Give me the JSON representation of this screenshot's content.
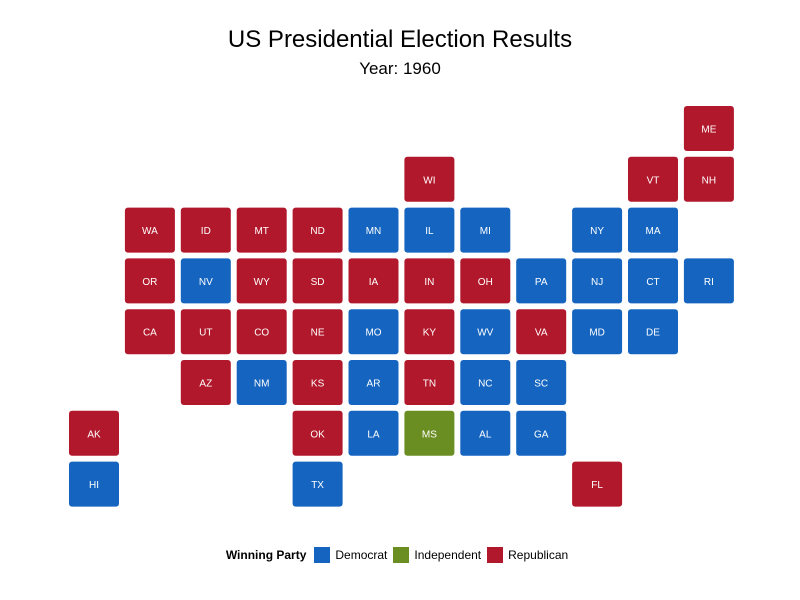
{
  "chart_data": {
    "type": "tile-map",
    "title": "US Presidential Election Results",
    "subtitle": "Year: 1960",
    "colors": {
      "Democrat": "#1565c0",
      "Independent": "#6b8e23",
      "Republican": "#b2182b"
    },
    "legend": {
      "title": "Winning Party",
      "placement": "bottom",
      "entries": [
        "Democrat",
        "Independent",
        "Republican"
      ]
    },
    "states": [
      {
        "state": "ME",
        "col": 11,
        "row": 0,
        "party": "Republican"
      },
      {
        "state": "WI",
        "col": 6,
        "row": 1,
        "party": "Republican"
      },
      {
        "state": "VT",
        "col": 10,
        "row": 1,
        "party": "Republican"
      },
      {
        "state": "NH",
        "col": 11,
        "row": 1,
        "party": "Republican"
      },
      {
        "state": "WA",
        "col": 1,
        "row": 2,
        "party": "Republican"
      },
      {
        "state": "ID",
        "col": 2,
        "row": 2,
        "party": "Republican"
      },
      {
        "state": "MT",
        "col": 3,
        "row": 2,
        "party": "Republican"
      },
      {
        "state": "ND",
        "col": 4,
        "row": 2,
        "party": "Republican"
      },
      {
        "state": "MN",
        "col": 5,
        "row": 2,
        "party": "Democrat"
      },
      {
        "state": "IL",
        "col": 6,
        "row": 2,
        "party": "Democrat"
      },
      {
        "state": "MI",
        "col": 7,
        "row": 2,
        "party": "Democrat"
      },
      {
        "state": "NY",
        "col": 9,
        "row": 2,
        "party": "Democrat"
      },
      {
        "state": "MA",
        "col": 10,
        "row": 2,
        "party": "Democrat"
      },
      {
        "state": "OR",
        "col": 1,
        "row": 3,
        "party": "Republican"
      },
      {
        "state": "NV",
        "col": 2,
        "row": 3,
        "party": "Democrat"
      },
      {
        "state": "WY",
        "col": 3,
        "row": 3,
        "party": "Republican"
      },
      {
        "state": "SD",
        "col": 4,
        "row": 3,
        "party": "Republican"
      },
      {
        "state": "IA",
        "col": 5,
        "row": 3,
        "party": "Republican"
      },
      {
        "state": "IN",
        "col": 6,
        "row": 3,
        "party": "Republican"
      },
      {
        "state": "OH",
        "col": 7,
        "row": 3,
        "party": "Republican"
      },
      {
        "state": "PA",
        "col": 8,
        "row": 3,
        "party": "Democrat"
      },
      {
        "state": "NJ",
        "col": 9,
        "row": 3,
        "party": "Democrat"
      },
      {
        "state": "CT",
        "col": 10,
        "row": 3,
        "party": "Democrat"
      },
      {
        "state": "RI",
        "col": 11,
        "row": 3,
        "party": "Democrat"
      },
      {
        "state": "CA",
        "col": 1,
        "row": 4,
        "party": "Republican"
      },
      {
        "state": "UT",
        "col": 2,
        "row": 4,
        "party": "Republican"
      },
      {
        "state": "CO",
        "col": 3,
        "row": 4,
        "party": "Republican"
      },
      {
        "state": "NE",
        "col": 4,
        "row": 4,
        "party": "Republican"
      },
      {
        "state": "MO",
        "col": 5,
        "row": 4,
        "party": "Democrat"
      },
      {
        "state": "KY",
        "col": 6,
        "row": 4,
        "party": "Republican"
      },
      {
        "state": "WV",
        "col": 7,
        "row": 4,
        "party": "Democrat"
      },
      {
        "state": "VA",
        "col": 8,
        "row": 4,
        "party": "Republican"
      },
      {
        "state": "MD",
        "col": 9,
        "row": 4,
        "party": "Democrat"
      },
      {
        "state": "DE",
        "col": 10,
        "row": 4,
        "party": "Democrat"
      },
      {
        "state": "AZ",
        "col": 2,
        "row": 5,
        "party": "Republican"
      },
      {
        "state": "NM",
        "col": 3,
        "row": 5,
        "party": "Democrat"
      },
      {
        "state": "KS",
        "col": 4,
        "row": 5,
        "party": "Republican"
      },
      {
        "state": "AR",
        "col": 5,
        "row": 5,
        "party": "Democrat"
      },
      {
        "state": "TN",
        "col": 6,
        "row": 5,
        "party": "Republican"
      },
      {
        "state": "NC",
        "col": 7,
        "row": 5,
        "party": "Democrat"
      },
      {
        "state": "SC",
        "col": 8,
        "row": 5,
        "party": "Democrat"
      },
      {
        "state": "AK",
        "col": 0,
        "row": 6,
        "party": "Republican"
      },
      {
        "state": "OK",
        "col": 4,
        "row": 6,
        "party": "Republican"
      },
      {
        "state": "LA",
        "col": 5,
        "row": 6,
        "party": "Democrat"
      },
      {
        "state": "MS",
        "col": 6,
        "row": 6,
        "party": "Independent"
      },
      {
        "state": "AL",
        "col": 7,
        "row": 6,
        "party": "Democrat"
      },
      {
        "state": "GA",
        "col": 8,
        "row": 6,
        "party": "Democrat"
      },
      {
        "state": "HI",
        "col": 0,
        "row": 7,
        "party": "Democrat"
      },
      {
        "state": "TX",
        "col": 4,
        "row": 7,
        "party": "Democrat"
      },
      {
        "state": "FL",
        "col": 9,
        "row": 7,
        "party": "Republican"
      }
    ]
  }
}
